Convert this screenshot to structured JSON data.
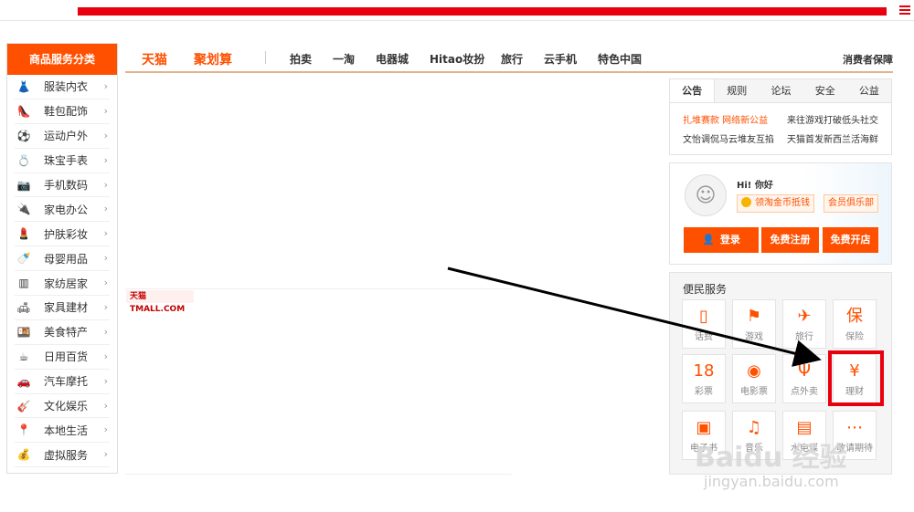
{
  "header": {
    "menu_icon": "menu-icon"
  },
  "categories": {
    "title": "商品服务分类",
    "items": [
      {
        "label": "服装内衣",
        "icon": "clothing-icon"
      },
      {
        "label": "鞋包配饰",
        "icon": "shoe-icon"
      },
      {
        "label": "运动户外",
        "icon": "ball-icon"
      },
      {
        "label": "珠宝手表",
        "icon": "jewelry-icon"
      },
      {
        "label": "手机数码",
        "icon": "camera-icon"
      },
      {
        "label": "家电办公",
        "icon": "appliance-icon"
      },
      {
        "label": "护肤彩妆",
        "icon": "cosmetics-icon"
      },
      {
        "label": "母婴用品",
        "icon": "baby-icon"
      },
      {
        "label": "家纺居家",
        "icon": "curtain-icon"
      },
      {
        "label": "家具建材",
        "icon": "furniture-icon"
      },
      {
        "label": "美食特产",
        "icon": "food-icon"
      },
      {
        "label": "日用百货",
        "icon": "cup-icon"
      },
      {
        "label": "汽车摩托",
        "icon": "car-icon"
      },
      {
        "label": "文化娱乐",
        "icon": "guitar-icon"
      },
      {
        "label": "本地生活",
        "icon": "location-icon"
      },
      {
        "label": "虚拟服务",
        "icon": "coins-icon"
      }
    ]
  },
  "nav": {
    "brand1": "天猫",
    "brand2": "聚划算",
    "links": [
      "拍卖",
      "一淘",
      "电器城",
      "Hitao妆扮",
      "旅行",
      "云手机",
      "特色中国"
    ],
    "right": "消费者保障"
  },
  "tmall_logo": "天猫 TMALL.COM",
  "notice": {
    "tabs": [
      "公告",
      "规则",
      "论坛",
      "安全",
      "公益"
    ],
    "rows": [
      [
        "扎堆赛款 网络新公益",
        "来往游戏打破低头社交"
      ],
      [
        "文怡调侃马云堆友互掐",
        "天猫首发新西兰活海鲜"
      ]
    ]
  },
  "user": {
    "greeting": "Hi! 你好",
    "coin_btn": "领淘金币抵钱",
    "club_btn": "会员俱乐部",
    "login": "登录",
    "register": "免费注册",
    "open_shop": "免费开店"
  },
  "services": {
    "title": "便民服务",
    "items": [
      {
        "label": "话费",
        "icon": "phone-icon",
        "glyph": "▯"
      },
      {
        "label": "游戏",
        "icon": "game-icon",
        "glyph": "⚑"
      },
      {
        "label": "旅行",
        "icon": "plane-icon",
        "glyph": "✈"
      },
      {
        "label": "保险",
        "icon": "insurance-icon",
        "glyph": "保"
      },
      {
        "label": "彩票",
        "icon": "lottery-icon",
        "glyph": "18"
      },
      {
        "label": "电影票",
        "icon": "film-icon",
        "glyph": "◉"
      },
      {
        "label": "点外卖",
        "icon": "fork-icon",
        "glyph": "Ψ"
      },
      {
        "label": "理财",
        "icon": "money-bag-icon",
        "glyph": "¥"
      },
      {
        "label": "电子书",
        "icon": "book-icon",
        "glyph": "▣"
      },
      {
        "label": "音乐",
        "icon": "music-icon",
        "glyph": "♫"
      },
      {
        "label": "水电煤",
        "icon": "wallet-icon",
        "glyph": "▤"
      },
      {
        "label": "敬请期待",
        "icon": "more-icon",
        "glyph": "⋯"
      }
    ]
  },
  "watermark": {
    "line1": "Baidu 经验",
    "line2": "jingyan.baidu.com"
  },
  "colors": {
    "accent": "#ff5000",
    "highlight": "#e8000f"
  }
}
